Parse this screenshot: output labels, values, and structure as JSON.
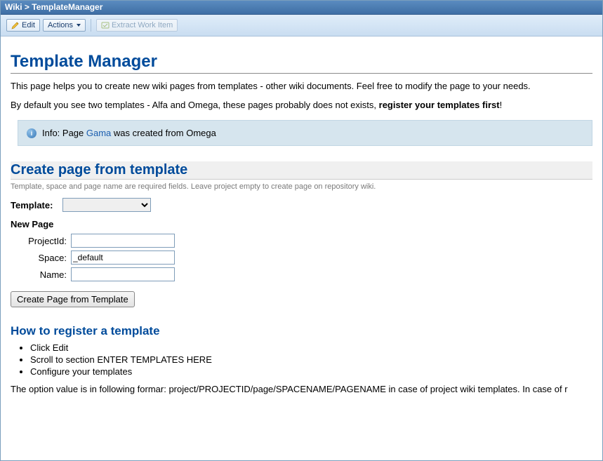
{
  "window": {
    "breadcrumb_root": "Wiki",
    "breadcrumb_sep": " > ",
    "breadcrumb_page": "TemplateManager"
  },
  "toolbar": {
    "edit_label": "Edit",
    "actions_label": "Actions",
    "extract_label": "Extract Work Item"
  },
  "page": {
    "title": "Template Manager",
    "intro1": "This page helps you to create new wiki pages from templates - other wiki documents. Feel free to modify the page to your needs.",
    "intro2_a": "By default you see two templates - Alfa and Omega, these pages probably does not exists, ",
    "intro2_b": "register your templates first",
    "intro2_c": "!"
  },
  "info": {
    "prefix": "Info: Page ",
    "link_text": "Gama",
    "suffix": " was created from Omega"
  },
  "create": {
    "section_title": "Create page from template",
    "hint": "Template, space and page name are required fields. Leave project empty to create page on repository wiki.",
    "template_label": "Template:",
    "new_page_heading": "New Page",
    "projectid_label": "ProjectId:",
    "space_label": "Space:",
    "space_value": "_default",
    "name_label": "Name:",
    "submit_label": "Create Page from Template"
  },
  "howto": {
    "section_title": "How to register a template",
    "steps": [
      "Click Edit",
      "Scroll to section ENTER TEMPLATES HERE",
      "Configure your templates"
    ],
    "footer": "The option value is in following formar: project/PROJECTID/page/SPACENAME/PAGENAME in case of project wiki templates. In case of r"
  }
}
